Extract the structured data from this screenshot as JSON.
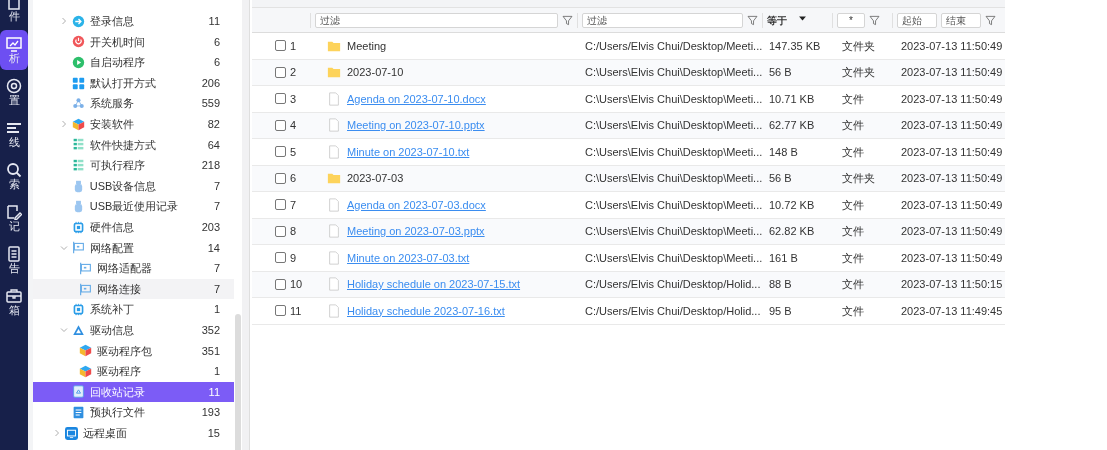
{
  "rail": [
    {
      "label": "件",
      "selected": false
    },
    {
      "label": "析",
      "selected": true
    },
    {
      "label": "置",
      "selected": false
    },
    {
      "label": "线",
      "selected": false
    },
    {
      "label": "索",
      "selected": false
    },
    {
      "label": "记",
      "selected": false
    },
    {
      "label": "告",
      "selected": false
    },
    {
      "label": "箱",
      "selected": false
    }
  ],
  "sidebar": {
    "items": [
      {
        "label": "登录信息",
        "count": "11",
        "expanded": false,
        "selected": false
      },
      {
        "label": "开关机时间",
        "count": "6",
        "selected": false
      },
      {
        "label": "自启动程序",
        "count": "6",
        "selected": false
      },
      {
        "label": "默认打开方式",
        "count": "206",
        "selected": false
      },
      {
        "label": "系统服务",
        "count": "559",
        "selected": false
      },
      {
        "label": "安装软件",
        "count": "82",
        "expanded": false,
        "selected": false
      },
      {
        "label": "软件快捷方式",
        "count": "64",
        "selected": false
      },
      {
        "label": "可执行程序",
        "count": "218",
        "selected": false
      },
      {
        "label": "USB设备信息",
        "count": "7",
        "selected": false
      },
      {
        "label": "USB最近使用记录",
        "count": "7",
        "selected": false
      },
      {
        "label": "硬件信息",
        "count": "203",
        "selected": false
      },
      {
        "label": "网络配置",
        "count": "14",
        "expanded": true,
        "selected": false,
        "children": [
          {
            "label": "网络适配器",
            "count": "7",
            "selected": false
          },
          {
            "label": "网络连接",
            "count": "7",
            "selected": false,
            "hovered": true
          }
        ]
      },
      {
        "label": "系统补丁",
        "count": "1",
        "selected": false
      },
      {
        "label": "驱动信息",
        "count": "352",
        "expanded": true,
        "selected": false,
        "children": [
          {
            "label": "驱动程序包",
            "count": "351",
            "selected": false
          },
          {
            "label": "驱动程序",
            "count": "1",
            "selected": false
          }
        ]
      },
      {
        "label": "回收站记录",
        "count": "11",
        "selected": true
      },
      {
        "label": "预执行文件",
        "count": "193",
        "selected": false
      }
    ],
    "root_items": [
      {
        "label": "远程桌面",
        "count": "15",
        "expanded": false,
        "selected": false
      }
    ]
  },
  "filters": {
    "name": {
      "placeholder": "过滤"
    },
    "path": {
      "placeholder": "过滤"
    },
    "size": {
      "operator": "等于"
    },
    "type": {
      "value": "*"
    },
    "time": {
      "from_placeholder": "起始",
      "to_placeholder": "结束"
    }
  },
  "table": {
    "rows": [
      {
        "checked": false,
        "number": "1",
        "kind": "folder",
        "name": "Meeting",
        "path": "C:/Users/Elvis Chui/Desktop/Meeti...",
        "size": "147.35 KB",
        "type": "文件夹",
        "time": "2023-07-13 11:50:49"
      },
      {
        "checked": false,
        "number": "2",
        "kind": "folder",
        "name": "2023-07-10",
        "path": "C:\\Users\\Elvis Chui\\Desktop\\Meeti...",
        "size": "56 B",
        "type": "文件夹",
        "time": "2023-07-13 11:50:49"
      },
      {
        "checked": false,
        "number": "3",
        "kind": "file",
        "name": "Agenda on 2023-07-10.docx",
        "path": "C:\\Users\\Elvis Chui\\Desktop\\Meeti...",
        "size": "10.71 KB",
        "type": "文件",
        "time": "2023-07-13 11:50:49"
      },
      {
        "checked": false,
        "number": "4",
        "kind": "file",
        "name": "Meeting on 2023-07-10.pptx",
        "path": "C:\\Users\\Elvis Chui\\Desktop\\Meeti...",
        "size": "62.77 KB",
        "type": "文件",
        "time": "2023-07-13 11:50:49"
      },
      {
        "checked": false,
        "number": "5",
        "kind": "file",
        "name": "Minute on 2023-07-10.txt",
        "path": "C:\\Users\\Elvis Chui\\Desktop\\Meeti...",
        "size": "148 B",
        "type": "文件",
        "time": "2023-07-13 11:50:49"
      },
      {
        "checked": false,
        "number": "6",
        "kind": "folder",
        "name": "2023-07-03",
        "path": "C:\\Users\\Elvis Chui\\Desktop\\Meeti...",
        "size": "56 B",
        "type": "文件夹",
        "time": "2023-07-13 11:50:49"
      },
      {
        "checked": false,
        "number": "7",
        "kind": "file",
        "name": "Agenda on 2023-07-03.docx",
        "path": "C:\\Users\\Elvis Chui\\Desktop\\Meeti...",
        "size": "10.72 KB",
        "type": "文件",
        "time": "2023-07-13 11:50:49"
      },
      {
        "checked": false,
        "number": "8",
        "kind": "file",
        "name": "Meeting on 2023-07-03.pptx",
        "path": "C:\\Users\\Elvis Chui\\Desktop\\Meeti...",
        "size": "62.82 KB",
        "type": "文件",
        "time": "2023-07-13 11:50:49"
      },
      {
        "checked": false,
        "number": "9",
        "kind": "file",
        "name": "Minute on 2023-07-03.txt",
        "path": "C:\\Users\\Elvis Chui\\Desktop\\Meeti...",
        "size": "161 B",
        "type": "文件",
        "time": "2023-07-13 11:50:49"
      },
      {
        "checked": false,
        "number": "10",
        "kind": "file",
        "name": "Holiday schedule on 2023-07-15.txt",
        "path": "C:/Users/Elvis Chui/Desktop/Holid...",
        "size": "88 B",
        "type": "文件",
        "time": "2023-07-13 11:50:15"
      },
      {
        "checked": false,
        "number": "11",
        "kind": "file",
        "name": "Holiday schedule 2023-07-16.txt",
        "path": "C:/Users/Elvis Chui/Desktop/Holid...",
        "size": "95 B",
        "type": "文件",
        "time": "2023-07-13 11:49:45"
      }
    ]
  }
}
